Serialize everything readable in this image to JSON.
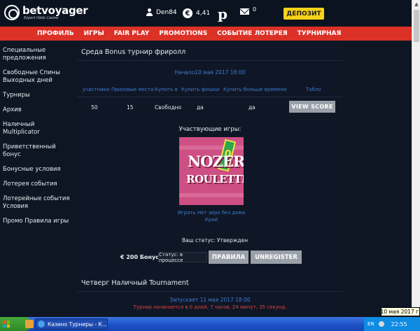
{
  "header": {
    "logo_name": "betvoyager",
    "logo_tagline": "Expert Odds Casino",
    "username": "Den84",
    "euro_symbol": "€",
    "balance": "4,41",
    "points_symbol": "p",
    "messages_count": "0",
    "deposit_label": "ДЕПОЗИТ"
  },
  "nav": {
    "items": [
      "ПРОФИЛЬ",
      "ИГРЫ",
      "FAIR PLAY",
      "PROMOTIONS",
      "СОБЫТИЕ ЛОТЕРЕЯ",
      "ТУРНИРНАЯ"
    ]
  },
  "sidebar": {
    "items": [
      "Специальные предложения",
      "Свободные Спины Выходных дней",
      "Турниры",
      "Архив",
      "Наличный Multiplicator",
      "Приветственный бонус",
      "Бонусные условия",
      "Лотерея события",
      "Лотерейные события Условия",
      "Промо Правила игры"
    ]
  },
  "tournament1": {
    "title": "Среда Bonus турнир фриролл",
    "start": "Начало10 мая 2017 18:00",
    "columns": [
      "участники",
      "Призовые места",
      "Купить в",
      "Купить фишки",
      "Купить больше времени",
      "Табло"
    ],
    "row": [
      "50",
      "15",
      "Свободно",
      "да",
      "да"
    ],
    "view_score_label": "VIEW SCORE",
    "games_label": "Участвующие игры:",
    "game_thumb_title": "NOZER",
    "game_thumb_subtitle": "ROULETTE",
    "game_caption": "Играть Нет зеро без дома Край",
    "your_status": "Ваш статус:  Утвержден",
    "bonus_amount": "€ 200 Бонус",
    "status_pill": "Статус: в процессе",
    "rules_label": "ПРАВИЛА",
    "unregister_label": "UNREGISTER"
  },
  "tournament2": {
    "title": "Четверг Наличный Tournament",
    "start": "Запускает 11 мая 2017 18:00",
    "countdown": "Турнир начинается в 0 дней, 7 часов, 24 минут, 35 секунд."
  },
  "taskbar": {
    "window_title": "Казино Турниры - К...",
    "language": "EN",
    "clock": "22:55",
    "date_tooltip": "10 мая 2017 г."
  },
  "colors": {
    "nav_red": "#dc3127",
    "deposit_yellow": "#f7d21a",
    "link_blue": "#3e7bd0",
    "countdown_red": "#e04238",
    "page_dark": "#0e1624"
  }
}
